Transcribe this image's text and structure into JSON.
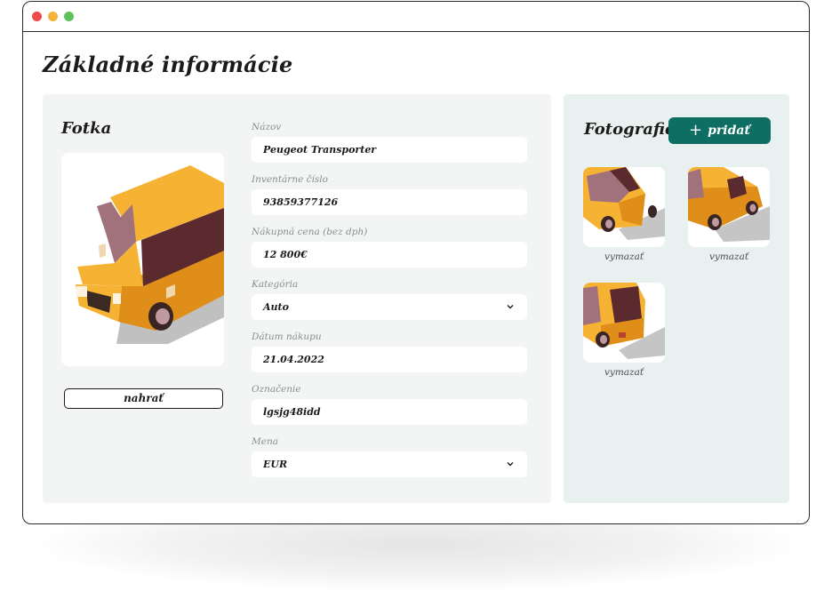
{
  "window": {
    "controls": [
      "close",
      "minimize",
      "maximize"
    ]
  },
  "page": {
    "title": "Základné informácie"
  },
  "photo_section": {
    "heading": "Fotka",
    "image_icon": "car-illustration",
    "upload_label": "nahrať"
  },
  "form": {
    "name": {
      "label": "Názov",
      "value": "Peugeot Transporter"
    },
    "inventory_number": {
      "label": "Inventárne číslo",
      "value": "93859377126"
    },
    "purchase_price": {
      "label": "Nákupná cena (bez dph)",
      "value": "12 800€"
    },
    "category": {
      "label": "Kategória",
      "value": "Auto"
    },
    "purchase_date": {
      "label": "Dátum nákupu",
      "value": "21.04.2022"
    },
    "designation": {
      "label": "Označenie",
      "value": "lgsjg48idd"
    },
    "currency": {
      "label": "Mena",
      "value": "EUR"
    }
  },
  "gallery": {
    "heading": "Fotografie",
    "add_label": "pridať",
    "add_icon": "plus-icon",
    "items": [
      {
        "view": "front",
        "delete_label": "vymazať"
      },
      {
        "view": "side",
        "delete_label": "vymazať"
      },
      {
        "view": "front-angle",
        "delete_label": "vymazať"
      }
    ]
  },
  "colors": {
    "accent": "#0f6e63",
    "car_body": "#f6b232",
    "car_glass": "#a2727c",
    "panel_left": "#f3f4f4",
    "panel_right": "#e9f1f0"
  }
}
